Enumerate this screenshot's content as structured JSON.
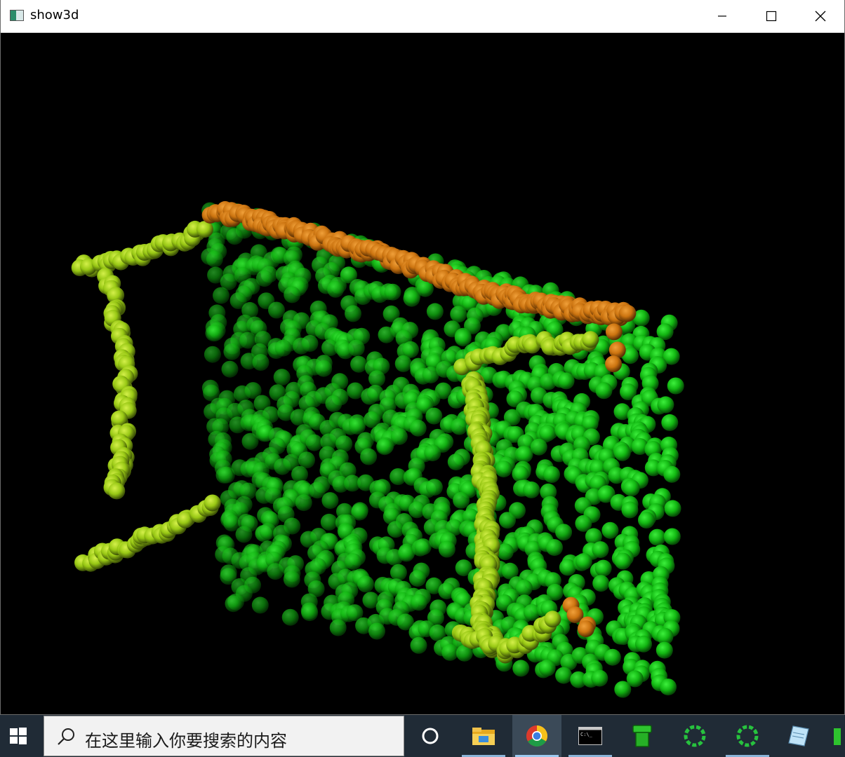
{
  "window": {
    "title": "show3d",
    "controls": {
      "minimize": "minimize",
      "maximize": "maximize",
      "close": "close"
    }
  },
  "viewport": {
    "background": "#000000",
    "colors": {
      "green": "#12c212",
      "yellow_green": "#a3d21a",
      "orange": "#d9800e"
    }
  },
  "taskbar": {
    "search_placeholder": "在这里输入你要搜索的内容",
    "items": [
      {
        "name": "cortana",
        "icon": "circle-icon"
      },
      {
        "name": "file-explorer",
        "icon": "folder-icon"
      },
      {
        "name": "chrome",
        "icon": "chrome-icon"
      },
      {
        "name": "command-prompt",
        "icon": "terminal-icon"
      },
      {
        "name": "app-green-pipe",
        "icon": "pipe-icon"
      },
      {
        "name": "app-loading-1",
        "icon": "spinner-icon"
      },
      {
        "name": "app-loading-2",
        "icon": "spinner-icon"
      },
      {
        "name": "notes",
        "icon": "notepad-icon"
      }
    ]
  }
}
